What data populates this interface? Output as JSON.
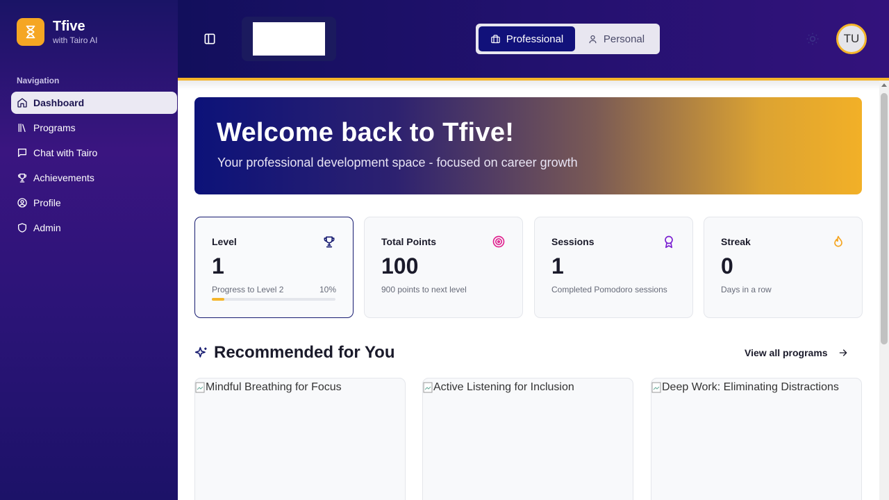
{
  "brand": {
    "name": "Tfive",
    "subtitle": "with Tairo AI",
    "accent": "#f5a623"
  },
  "sidebar": {
    "section_title": "Navigation",
    "items": [
      {
        "label": "Dashboard",
        "icon": "home-icon",
        "active": true
      },
      {
        "label": "Programs",
        "icon": "library-icon"
      },
      {
        "label": "Chat with Tairo",
        "icon": "chat-icon"
      },
      {
        "label": "Achievements",
        "icon": "trophy-icon"
      },
      {
        "label": "Profile",
        "icon": "user-circle-icon"
      },
      {
        "label": "Admin",
        "icon": "shield-icon"
      }
    ]
  },
  "header": {
    "modes": [
      {
        "label": "Professional",
        "icon": "briefcase-icon",
        "active": true
      },
      {
        "label": "Personal",
        "icon": "user-icon"
      }
    ],
    "avatar_initials": "TU",
    "accent_border": "#f5b52a"
  },
  "hero": {
    "title": "Welcome back to Tfive!",
    "subtitle": "Your professional development space - focused on career growth"
  },
  "stats": [
    {
      "label": "Level",
      "value": "1",
      "note": "Progress to Level 2",
      "percent": "10%",
      "progress": 0.1,
      "icon": "trophy-icon",
      "icon_color": "#161a70"
    },
    {
      "label": "Total Points",
      "value": "100",
      "note": "900 points to next level",
      "icon": "target-icon",
      "icon_color": "#e0238f"
    },
    {
      "label": "Sessions",
      "value": "1",
      "note": "Completed Pomodoro sessions",
      "icon": "award-icon",
      "icon_color": "#7a1fd1"
    },
    {
      "label": "Streak",
      "value": "0",
      "note": "Days in a row",
      "icon": "flame-icon",
      "icon_color": "#f5a623"
    }
  ],
  "recommended": {
    "title": "Recommended for You",
    "view_all": "View all programs",
    "programs": [
      {
        "image_alt": "Mindful Breathing for Focus"
      },
      {
        "image_alt": "Active Listening for Inclusion"
      },
      {
        "image_alt": "Deep Work: Eliminating Distractions"
      }
    ]
  }
}
